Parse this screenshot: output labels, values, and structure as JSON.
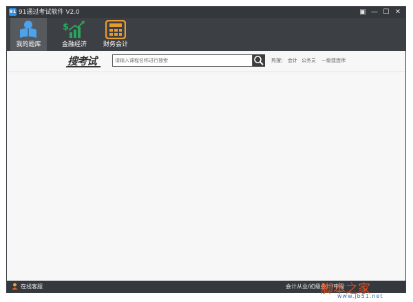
{
  "window": {
    "title": "91通过考试软件 V2.0",
    "app_icon_glyph": "91"
  },
  "window_controls": [
    "▣",
    "—",
    "☐",
    "✕"
  ],
  "toolbar": {
    "items": [
      {
        "label": "我的题库",
        "icon": "reader-icon",
        "active": true
      },
      {
        "label": "金融经济",
        "icon": "finance-chart-icon",
        "active": false
      },
      {
        "label": "财务会计",
        "icon": "calculator-icon",
        "active": false
      }
    ]
  },
  "search": {
    "logo": "搜考试",
    "placeholder": "请输入课程名称进行搜索",
    "hot_label": "热搜：",
    "hot_terms": [
      "会计",
      "公务员",
      "一级建造师"
    ]
  },
  "status": {
    "service": "在线客服",
    "marquee": "会计从业/初级会计/中级"
  },
  "watermark": {
    "text": "脚本之家",
    "url": "www.jb51.net"
  },
  "colors": {
    "titlebar": "#34373c",
    "toolbar": "#3c3f44",
    "accent_blue": "#2f8fe0",
    "finance_green": "#29a65b",
    "calc_orange": "#e89a2c"
  }
}
